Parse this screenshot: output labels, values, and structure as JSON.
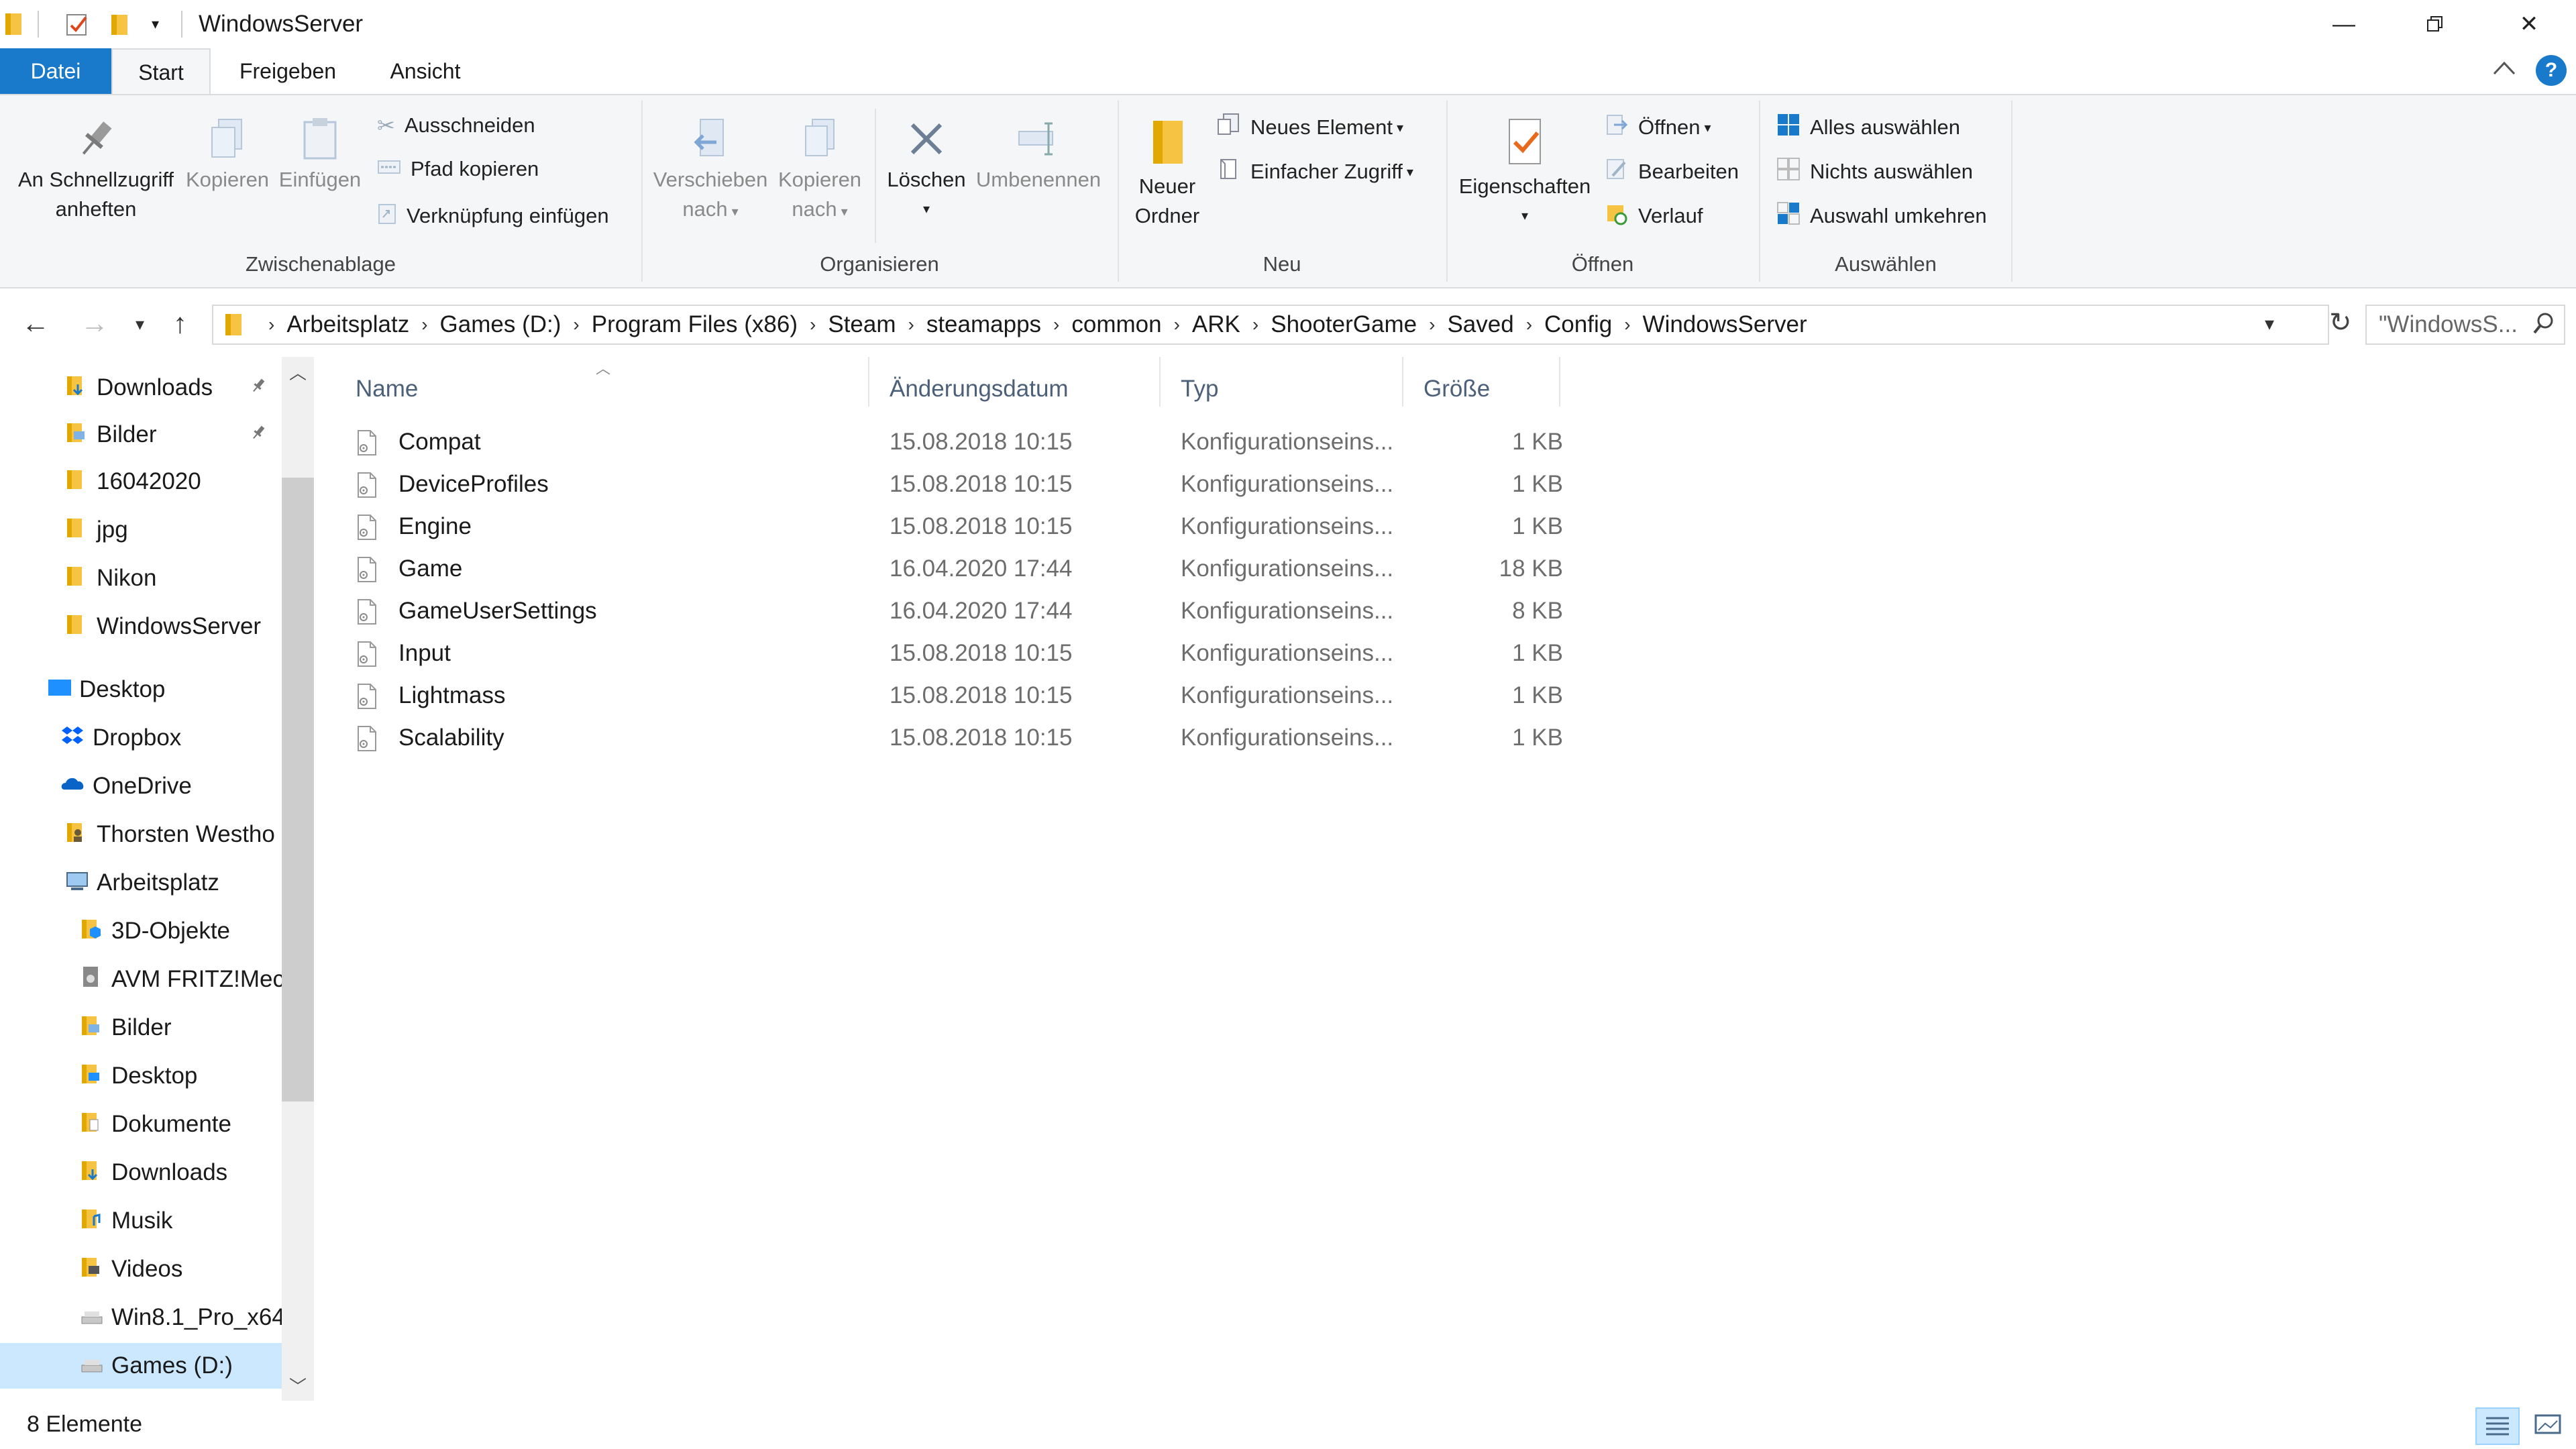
{
  "window": {
    "title": "WindowsServer",
    "controls": [
      "minimize",
      "restore",
      "close"
    ]
  },
  "ribbon_tabs": {
    "file": "Datei",
    "start": "Start",
    "share": "Freigeben",
    "view": "Ansicht"
  },
  "ribbon": {
    "clipboard": {
      "label": "Zwischenablage",
      "pin_label_1": "An Schnellzugriff",
      "pin_label_2": "anheften",
      "copy": "Kopieren",
      "paste": "Einfügen",
      "cut": "Ausschneiden",
      "copy_path": "Pfad kopieren",
      "paste_shortcut": "Verknüpfung einfügen"
    },
    "organize": {
      "label": "Organisieren",
      "move_1": "Verschieben",
      "move_2": "nach",
      "copyto_1": "Kopieren",
      "copyto_2": "nach",
      "delete": "Löschen",
      "rename": "Umbenennen"
    },
    "new": {
      "label": "Neu",
      "new_folder_1": "Neuer",
      "new_folder_2": "Ordner",
      "new_item": "Neues Element",
      "easy_access": "Einfacher Zugriff"
    },
    "open": {
      "label": "Öffnen",
      "properties": "Eigenschaften",
      "open": "Öffnen",
      "edit": "Bearbeiten",
      "history": "Verlauf"
    },
    "select": {
      "label": "Auswählen",
      "select_all": "Alles auswählen",
      "select_none": "Nichts auswählen",
      "invert": "Auswahl umkehren"
    }
  },
  "address": {
    "crumbs": [
      "Arbeitsplatz",
      "Games (D:)",
      "Program Files (x86)",
      "Steam",
      "steamapps",
      "common",
      "ARK",
      "ShooterGame",
      "Saved",
      "Config",
      "WindowsServer"
    ]
  },
  "search": {
    "placeholder": "\"WindowsS..."
  },
  "nav": [
    {
      "label": "Downloads",
      "icon": "downloads-folder-icon",
      "pinned": true
    },
    {
      "label": "Bilder",
      "icon": "pictures-folder-icon",
      "pinned": true
    },
    {
      "label": "16042020",
      "icon": "folder-icon"
    },
    {
      "label": "jpg",
      "icon": "folder-icon"
    },
    {
      "label": "Nikon",
      "icon": "folder-icon"
    },
    {
      "label": "WindowsServer",
      "icon": "folder-icon"
    },
    {
      "label": "Desktop",
      "icon": "desktop-icon"
    },
    {
      "label": "Dropbox",
      "icon": "dropbox-icon"
    },
    {
      "label": "OneDrive",
      "icon": "onedrive-icon"
    },
    {
      "label": "Thorsten Westho",
      "icon": "user-folder-icon"
    },
    {
      "label": "Arbeitsplatz",
      "icon": "computer-icon"
    },
    {
      "label": "3D-Objekte",
      "icon": "3d-objects-icon"
    },
    {
      "label": "AVM FRITZ!Mec",
      "icon": "media-server-icon"
    },
    {
      "label": "Bilder",
      "icon": "pictures-folder-icon"
    },
    {
      "label": "Desktop",
      "icon": "desktop-folder-icon"
    },
    {
      "label": "Dokumente",
      "icon": "documents-folder-icon"
    },
    {
      "label": "Downloads",
      "icon": "downloads-folder-icon"
    },
    {
      "label": "Musik",
      "icon": "music-folder-icon"
    },
    {
      "label": "Videos",
      "icon": "videos-folder-icon"
    },
    {
      "label": "Win8.1_Pro_x64",
      "icon": "drive-icon"
    },
    {
      "label": "Games (D:)",
      "icon": "drive-icon",
      "selected": true
    }
  ],
  "columns": {
    "name": "Name",
    "date": "Änderungsdatum",
    "type": "Typ",
    "size": "Größe"
  },
  "files": [
    {
      "name": "Compat",
      "date": "15.08.2018 10:15",
      "type": "Konfigurationseins...",
      "size": "1 KB"
    },
    {
      "name": "DeviceProfiles",
      "date": "15.08.2018 10:15",
      "type": "Konfigurationseins...",
      "size": "1 KB"
    },
    {
      "name": "Engine",
      "date": "15.08.2018 10:15",
      "type": "Konfigurationseins...",
      "size": "1 KB"
    },
    {
      "name": "Game",
      "date": "16.04.2020 17:44",
      "type": "Konfigurationseins...",
      "size": "18 KB"
    },
    {
      "name": "GameUserSettings",
      "date": "16.04.2020 17:44",
      "type": "Konfigurationseins...",
      "size": "8 KB"
    },
    {
      "name": "Input",
      "date": "15.08.2018 10:15",
      "type": "Konfigurationseins...",
      "size": "1 KB"
    },
    {
      "name": "Lightmass",
      "date": "15.08.2018 10:15",
      "type": "Konfigurationseins...",
      "size": "1 KB"
    },
    {
      "name": "Scalability",
      "date": "15.08.2018 10:15",
      "type": "Konfigurationseins...",
      "size": "1 KB"
    }
  ],
  "status": {
    "count": "8 Elemente"
  },
  "colors": {
    "accent": "#1979ca",
    "selection": "#cce8ff",
    "header_text": "#4c607a",
    "folder": "#f6c343"
  }
}
